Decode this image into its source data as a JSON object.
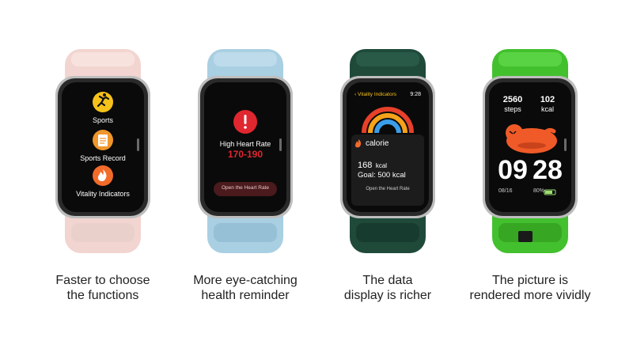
{
  "colors": {
    "pink_band": "#f2d5d0",
    "blue_band": "#a9cfe2",
    "green_band": "#1f4a3a",
    "lime_band": "#43c02e",
    "screen": "#0a0a0a",
    "accent_yellow": "#f6c21a",
    "alert_red": "#e0262f",
    "orange_red": "#f26b2a"
  },
  "bands": [
    {
      "caption_line1": "Faster to choose",
      "caption_line2": "the functions",
      "screen": {
        "items": [
          {
            "label": "Sports",
            "icon": "running-icon"
          },
          {
            "label": "Sports Record",
            "icon": "clipboard-icon"
          },
          {
            "label": "Vitality Indicators",
            "icon": "flame-icon"
          }
        ]
      }
    },
    {
      "caption_line1": "More eye-catching",
      "caption_line2": "health reminder",
      "screen": {
        "alert_icon": "exclamation-icon",
        "title": "High Heart Rate",
        "value": "170-190",
        "button": "Open the Heart Rate"
      }
    },
    {
      "caption_line1": "The data",
      "caption_line2": "display is richer",
      "screen": {
        "back_label": "Vitality Indicators",
        "time": "9:28",
        "card_title": "calorie",
        "kcal_value": "168",
        "kcal_unit": "kcal",
        "goal": "Goal: 500 kcal",
        "button": "Open the Heart Rate"
      }
    },
    {
      "caption_line1": "The picture is",
      "caption_line2": "rendered more vividly",
      "screen": {
        "steps_value": "2560",
        "steps_label": "steps",
        "kcal_value": "102",
        "kcal_label": "kcal",
        "hour": "09",
        "minute": "28",
        "date": "08/16",
        "battery": "80%"
      }
    }
  ]
}
